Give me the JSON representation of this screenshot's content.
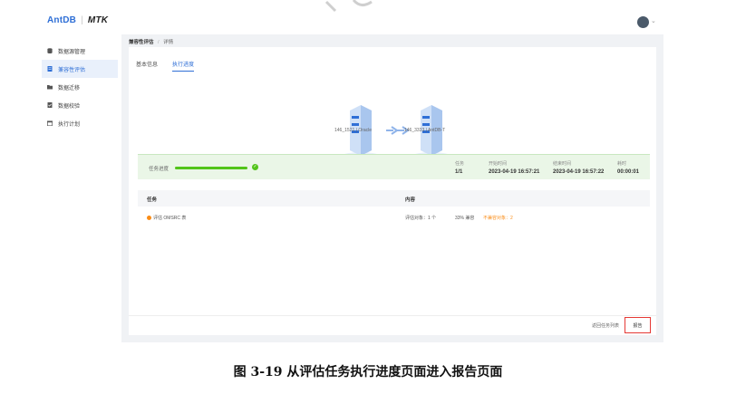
{
  "header": {
    "logo_primary": "AntDB",
    "logo_secondary": "MTK"
  },
  "sidebar": {
    "items": [
      {
        "label": "数据源管理",
        "icon": "database-icon",
        "active": false
      },
      {
        "label": "兼容性评估",
        "icon": "document-icon",
        "active": true
      },
      {
        "label": "数据迁移",
        "icon": "folder-icon",
        "active": false
      },
      {
        "label": "数据校验",
        "icon": "check-file-icon",
        "active": false
      },
      {
        "label": "执行计划",
        "icon": "calendar-icon",
        "active": false
      }
    ]
  },
  "breadcrumb": {
    "parent": "兼容性评估",
    "separator": "/",
    "current": "详情"
  },
  "tabs": [
    {
      "label": "基本信息",
      "active": false
    },
    {
      "label": "执行进度",
      "active": true
    }
  ],
  "flow": {
    "source_label": "146_1521 | Oracle",
    "target_label": "146_3333 | AntDB-T"
  },
  "progress": {
    "label": "任务进度",
    "fraction": 1.0,
    "stats": [
      {
        "label": "任务",
        "value": "1/1"
      },
      {
        "label": "开始时间",
        "value": "2023-04-19 16:57:21"
      },
      {
        "label": "结束时间",
        "value": "2023-04-19 16:57:22"
      },
      {
        "label": "耗时",
        "value": "00:00:01"
      }
    ]
  },
  "table": {
    "headers": [
      "任务",
      "内容"
    ],
    "rows": [
      {
        "task": "评估 OMSRC 表",
        "content_count": "评估对象：1 个",
        "content_pct": "33% 兼容",
        "content_incompat": "不兼容对象：2"
      }
    ]
  },
  "footer": {
    "return_label": "返回任务列表",
    "report_label": "报告"
  },
  "caption": "图 3-19  从评估任务执行进度页面进入报告页面",
  "colors": {
    "accent": "#2f6fd6",
    "success": "#52c41a",
    "warning": "#fa8c16",
    "highlight_border": "#e53935"
  }
}
